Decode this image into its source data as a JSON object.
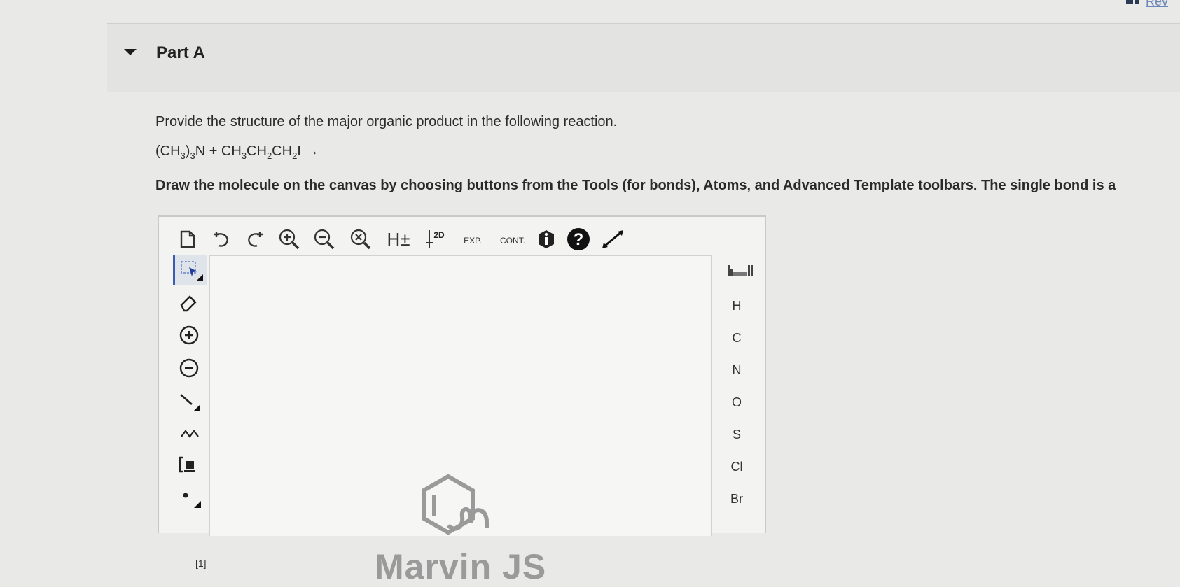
{
  "corner": {
    "label": "Rev"
  },
  "part": {
    "title": "Part A"
  },
  "question": {
    "prompt": "Provide the structure of the major organic product in the following reaction.",
    "equation": {
      "r1_a": "(CH",
      "r1_s1": "3",
      "r1_b": ")",
      "r1_s2": "3",
      "r1_c": "N + CH",
      "r2_s1": "3",
      "r2_b": "CH",
      "r2_s2": "2",
      "r2_c": "CH",
      "r2_s3": "2",
      "r2_d": "I →"
    },
    "instruction": "Draw the molecule on the canvas by choosing buttons from the Tools (for bonds), Atoms, and Advanced Template toolbars. The single bond is a"
  },
  "editor": {
    "top_toolbar": {
      "h_label": "H±",
      "clean2d_label": "2D",
      "expand_label": "EXP.",
      "contract_label": "CONT."
    },
    "atoms": [
      "H",
      "C",
      "N",
      "O",
      "S",
      "Cl",
      "Br"
    ],
    "bottom_left_label": "[1]",
    "brand": "Marvin JS"
  }
}
